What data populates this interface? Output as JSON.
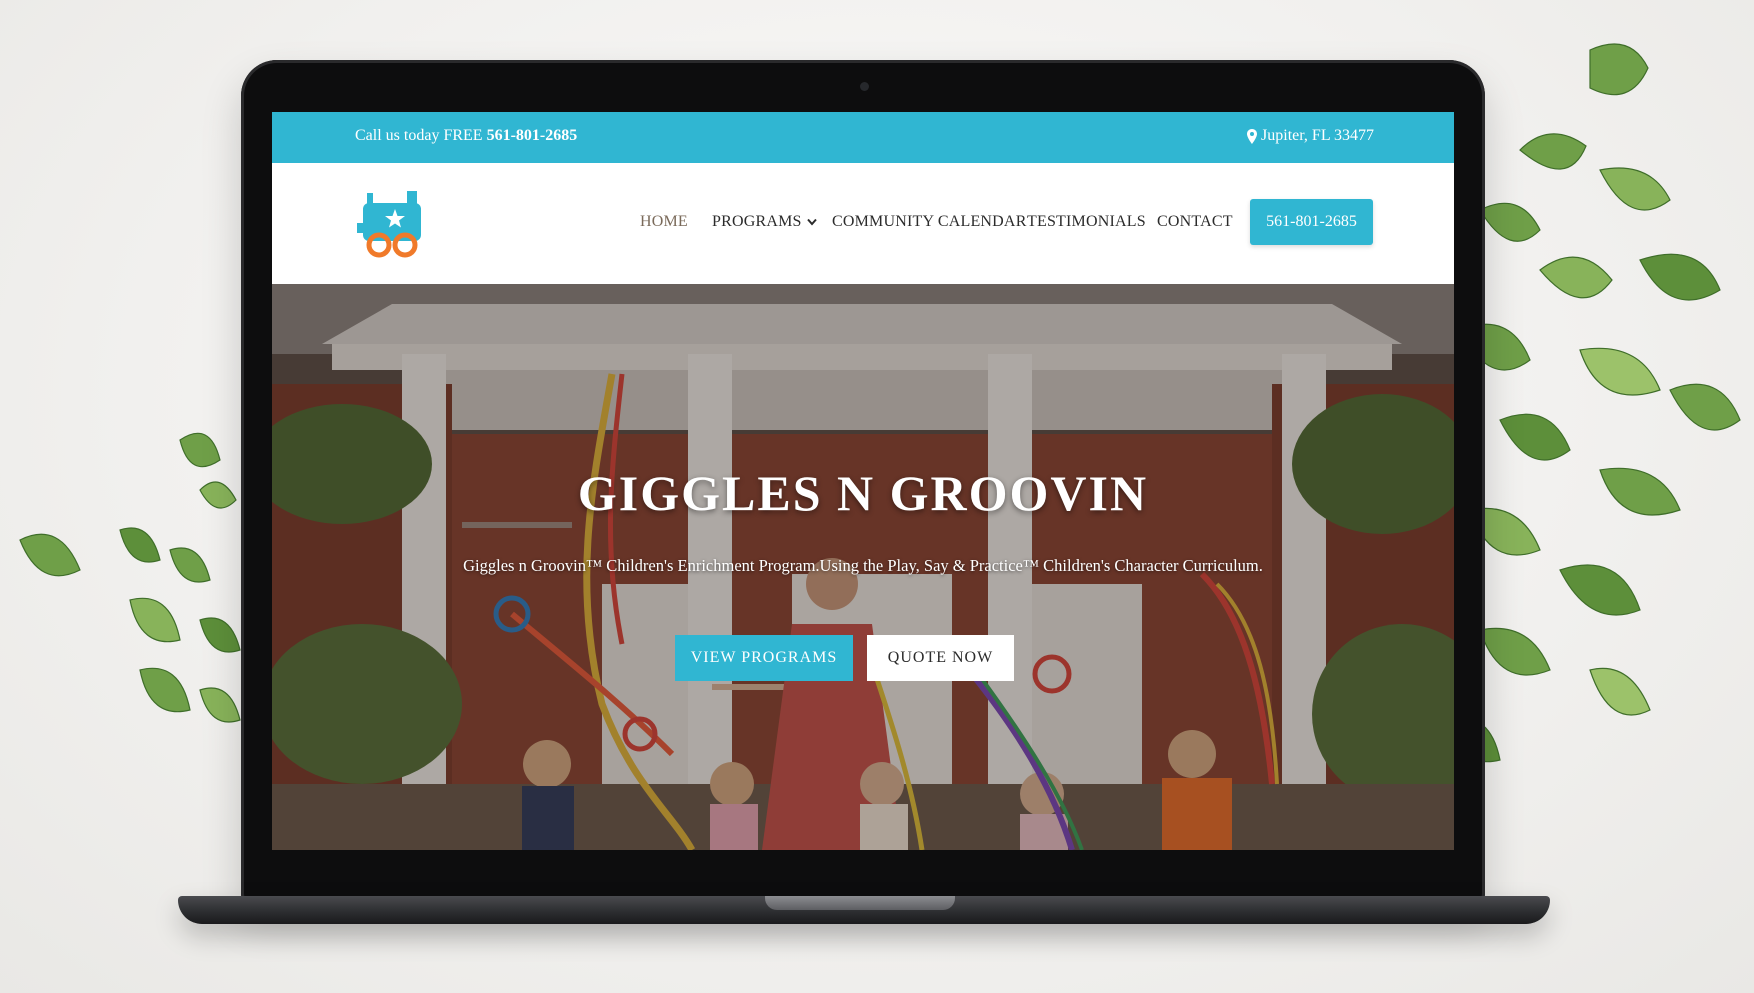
{
  "colors": {
    "accent": "#30b6d2",
    "white": "#ffffff",
    "nav_text": "#2b2b2b",
    "logo_blue": "#30b6d2",
    "logo_orange": "#f07a2a"
  },
  "topbar": {
    "call_prefix": "Call us today FREE",
    "phone": "561-801-2685",
    "location_icon": "map-marker-icon",
    "location": "Jupiter, FL 33477"
  },
  "header": {
    "logo_icon": "train-icon",
    "nav": [
      {
        "label": "HOME",
        "active": true
      },
      {
        "label": "PROGRAMS",
        "dropdown_icon": "chevron-down-icon"
      },
      {
        "label": "COMMUNITY CALENDAR"
      },
      {
        "label": "TESTIMONIALS"
      },
      {
        "label": "CONTACT"
      }
    ],
    "cta_label": "561-801-2685"
  },
  "hero": {
    "title": "GIGGLES N GROOVIN",
    "subtitle": "Giggles n Groovin™ Children's Enrichment Program.Using the Play, Say & Practice™ Children's Character Curriculum.",
    "primary_button": "VIEW PROGRAMS",
    "secondary_button": "QUOTE NOW"
  }
}
